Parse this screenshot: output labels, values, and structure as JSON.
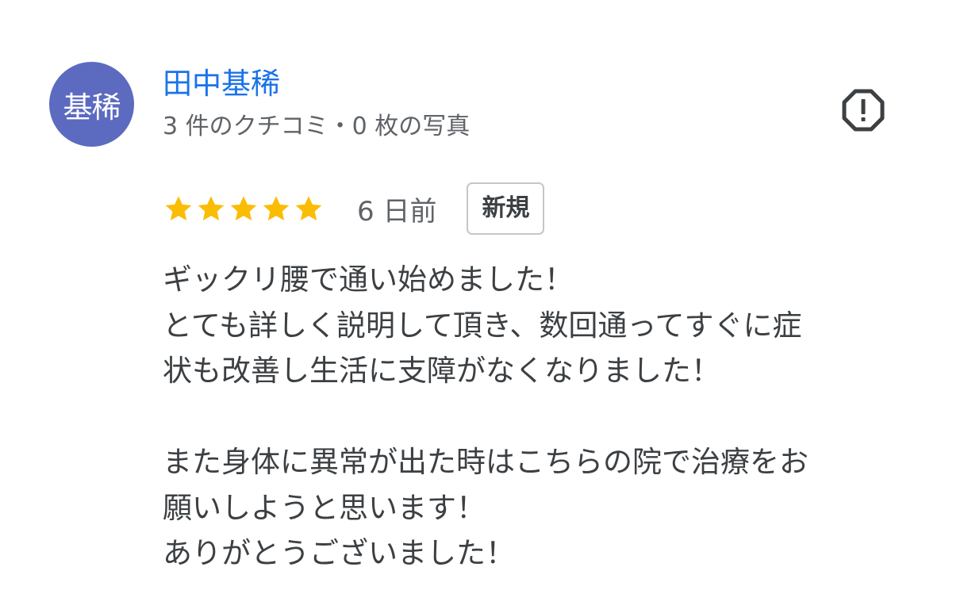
{
  "reviewer": {
    "avatar_text": "基稀",
    "avatar_color": "#5c6bc0",
    "name": "田中基稀",
    "name_color": "#1a73e8",
    "meta": "3 件のクチコミ・0 枚の写真"
  },
  "report": {
    "icon": "report-flag-icon"
  },
  "review": {
    "rating": 5,
    "max_rating": 5,
    "star_color": "#fbbc04",
    "date": "6 日前",
    "badge": "新規",
    "lines": [
      "ギックリ腰で通い始めました！",
      "とても詳しく説明して頂き、数回通ってすぐに症",
      "状も改善し生活に支障がなくなりました！",
      "",
      "また身体に異常が出た時はこちらの院で治療をお",
      "願いしようと思います！",
      "ありがとうございました！"
    ]
  }
}
